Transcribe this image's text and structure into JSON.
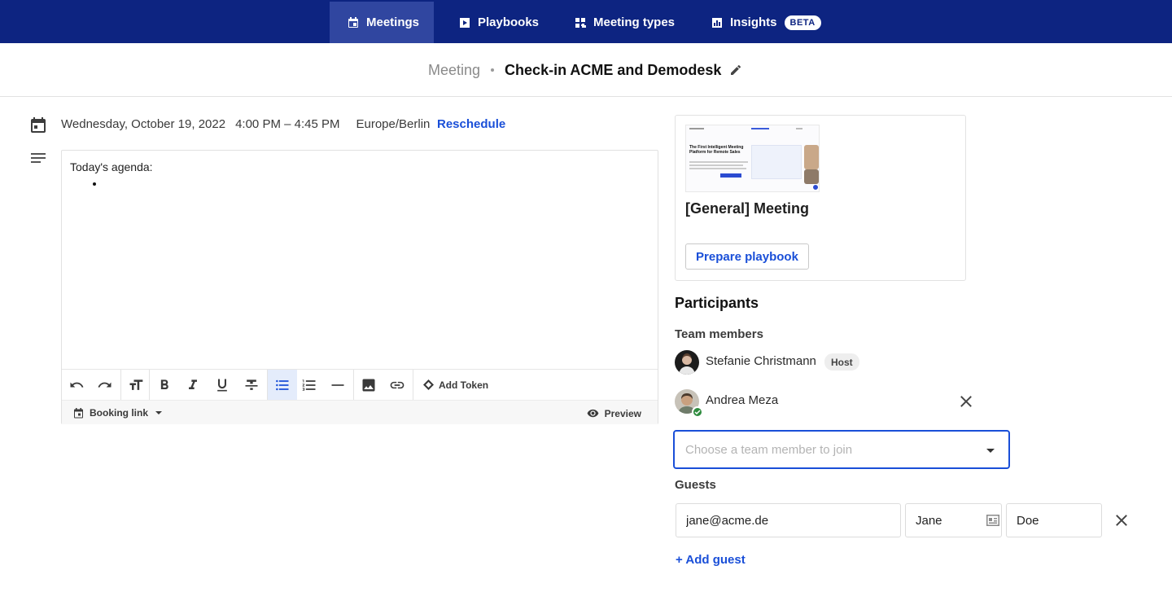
{
  "nav": {
    "items": [
      {
        "label": "Meetings",
        "icon": "calendar-icon",
        "active": true
      },
      {
        "label": "Playbooks",
        "icon": "play-icon",
        "active": false
      },
      {
        "label": "Meeting types",
        "icon": "grid-icon",
        "active": false
      },
      {
        "label": "Insights",
        "icon": "chart-icon",
        "active": false,
        "badge": "BETA"
      }
    ]
  },
  "header": {
    "crumb": "Meeting",
    "title": "Check-in ACME and Demodesk"
  },
  "schedule": {
    "date": "Wednesday, October 19, 2022",
    "time": "4:00 PM – 4:45 PM",
    "timezone": "Europe/Berlin",
    "reschedule_label": "Reschedule"
  },
  "editor": {
    "content": "Today's agenda:",
    "add_token_label": "Add Token",
    "booking_link_label": "Booking link",
    "preview_label": "Preview"
  },
  "playbook": {
    "thumb_heading": "The First Intelligent Meeting Platform for Remote Sales",
    "title": "[General] Meeting",
    "prepare_label": "Prepare playbook"
  },
  "participants": {
    "heading": "Participants",
    "team_label": "Team members",
    "members": [
      {
        "name": "Stefanie Christmann",
        "badge": "Host"
      },
      {
        "name": "Andrea Meza"
      }
    ],
    "select_placeholder": "Choose a team member to join",
    "guests_label": "Guests",
    "guest": {
      "email": "jane@acme.de",
      "first_name": "Jane",
      "last_name": "Doe"
    },
    "add_guest_label": "+ Add guest"
  },
  "colors": {
    "nav_bg": "#0d2481",
    "nav_active": "#3046a0",
    "accent": "#1a4fd8",
    "success": "#2e8b3e"
  }
}
